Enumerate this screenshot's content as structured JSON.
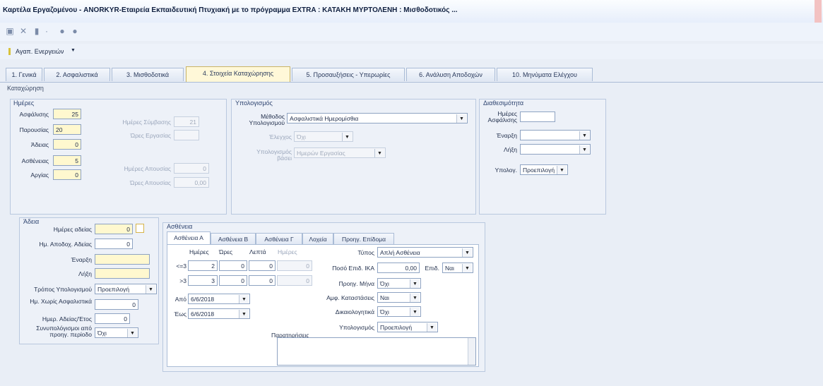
{
  "window": {
    "title": "Καρτέλα Εργαζομένου - ANORKYR-Εταιρεία Εκπαιδευτική Πτυχιακή με το πρόγραμμα EXTRA : ΚΑΤΑΚΗ ΜΥΡΤΟΛΕΝΗ : Μισθοδοτικός ..."
  },
  "quick_access": {
    "icons": [
      "save-icon",
      "delete-icon",
      "document-icon",
      "settings-icon",
      "nav-back-icon",
      "nav-forward-icon"
    ]
  },
  "menu": {
    "label": "Αγαπ. Ενεργειών",
    "arrow": "▼"
  },
  "tabs": [
    "1. Γενικά",
    "2. Ασφαλιστικά",
    "3. Μισθοδοτικά",
    "4. Στοιχεία Καταχώρησης",
    "5. Προσαυξήσεις - Υπερωρίες",
    "6. Ανάλυση Αποδοχών",
    "10. Μηνύματα Ελέγχου"
  ],
  "subheader": "Καταχώρηση",
  "days": {
    "title": "Ημέρες",
    "insurance_label": "Ασφάλισης",
    "insurance_value": "25",
    "presence_label": "Παρουσίας",
    "presence_value": "20",
    "leave_label": "Άδειας",
    "leave_value": "0",
    "sickness_label": "Ασθένειας",
    "sickness_value": "5",
    "absence_label": "Αργίας",
    "absence_value": "0",
    "contract_days_label": "Ημέρες Σύμβασης",
    "contract_days_value": "21",
    "hours_label": "Ώρες Εργασίας",
    "hours_value": "",
    "absence_days_label": "Ημέρες Απουσίας",
    "absence_days_value": "0",
    "absence_hours_label": "Ώρες Απουσίας",
    "absence_hours_value": "0,00"
  },
  "calc": {
    "title": "Υπολογισμός",
    "method_label": "Μέθοδος Υπολογισμού",
    "method_value": "Ασφαλιστικά Ημερομίσθια",
    "check_label": "Έλεγχος",
    "check_value": "Όχι",
    "basis_label": "Υπολογισμός βάσει",
    "basis_value": "Ημερών Εργασίας"
  },
  "availability": {
    "title": "Διαθεσιμότητα",
    "insurance_days_label": "Ημέρες Ασφάλισης",
    "insurance_days_value": "",
    "start_label": "Έναρξη",
    "start_value": "",
    "end_label": "Λήξη",
    "end_value": "",
    "calc_label": "Υπολογ.",
    "calc_value": "Προεπιλογή"
  },
  "leave": {
    "title": "Άδεια",
    "days_label": "Ημέρες αδείας",
    "days_value": "0",
    "paid_label": "Ημ. Αποδοχ. Αδείας",
    "paid_value": "0",
    "start_label": "Έναρξη",
    "start_value": "",
    "end_label": "Λήξη",
    "end_value": "",
    "method_label": "Τρόπος Υπολογισμού",
    "method_value": "Προεπιλογή",
    "no_insurance_label": "Ημ. Χωρίς Ασφαλιστικά",
    "no_insurance_value": "0",
    "per_year_label": "Ημερ. Αδείας/Έτος",
    "per_year_value": "0",
    "previous_label": "Συνυπολόγισμοι από προηγ. περίοδο",
    "previous_value": "Όχι"
  },
  "sickness": {
    "title": "Ασθένεια",
    "tabs": [
      "Ασθένεια Α",
      "Ασθένεια Β",
      "Ασθένεια Γ",
      "Λοχεία",
      "Προηγ. Επίδομα"
    ],
    "col_days": "Ημέρες",
    "col_hours": "Ώρες",
    "col_minutes": "Λεπτά",
    "col_extra": "Ημέρες",
    "row1_label": "<=3",
    "row1": [
      "2",
      "0",
      "0",
      "0"
    ],
    "row2_label": ">3",
    "row2": [
      "3",
      "0",
      "0",
      "0"
    ],
    "from_label": "Από",
    "from_value": "6/6/2018",
    "to_label": "Έως",
    "to_value": "6/6/2018",
    "type_label": "Τύπος",
    "type_value": "Απλή Ασθένεια",
    "ika_label": "Ποσό Επιδ. ΙΚΑ",
    "ika_value": "0,00",
    "allowance_label": "Επιδ.",
    "allowance_value": "Ναι",
    "prev_month_label": "Προηγ. Μήνα",
    "prev_month_value": "Όχι",
    "paid_label": "Αμφ. Καταστάσεις",
    "paid_value": "Ναι",
    "justified_label": "Δικαιολογητικά",
    "justified_value": "Όχι",
    "calc_label": "Υπολογισμός",
    "calc_value": "Προεπιλογή",
    "notes_label": "Παρατηρήσεις",
    "notes_value": ""
  }
}
